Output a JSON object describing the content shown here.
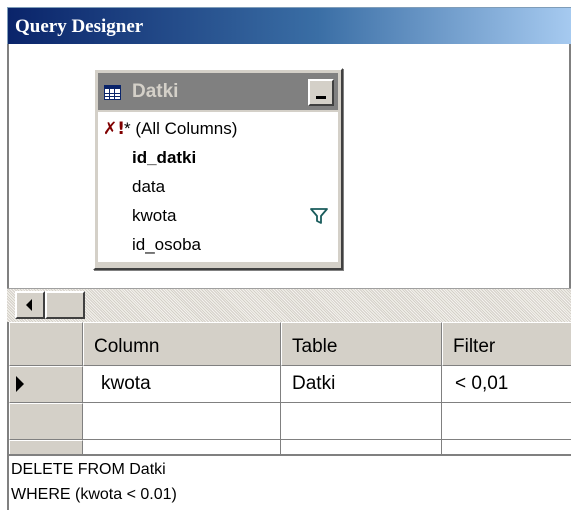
{
  "window": {
    "title": "Query Designer"
  },
  "diagram": {
    "table": {
      "name": "Datki",
      "icon": "table-grid-icon",
      "minimize_icon": "minimize-icon",
      "columns": [
        {
          "label": "* (All Columns)",
          "icon": "delete-query-icon",
          "bold": false
        },
        {
          "label": "id_datki",
          "bold": true
        },
        {
          "label": "data",
          "bold": false
        },
        {
          "label": "kwota",
          "bold": false,
          "icon": "filter-funnel-icon"
        },
        {
          "label": "id_osoba",
          "bold": false
        }
      ]
    }
  },
  "scrollbar": {
    "left_arrow_icon": "scroll-left-arrow-icon"
  },
  "grid": {
    "headers": [
      "Column",
      "Table",
      "Filter"
    ],
    "rows": [
      {
        "column": "kwota",
        "table": "Datki",
        "filter": "< 0,01",
        "current": true,
        "pointer_icon": "row-pointer-icon"
      },
      {
        "column": "",
        "table": "",
        "filter": "",
        "current": false
      }
    ]
  },
  "sql": {
    "lines": [
      "DELETE FROM Datki",
      "WHERE (kwota < 0.01)"
    ]
  },
  "colors": {
    "title_gradient_start": "#0a246a",
    "title_gradient_end": "#a6caf0",
    "face": "#d4d0c8",
    "table_header": "#808080",
    "filter_icon": "#1a5c5c",
    "delete_icon": "#800000"
  }
}
